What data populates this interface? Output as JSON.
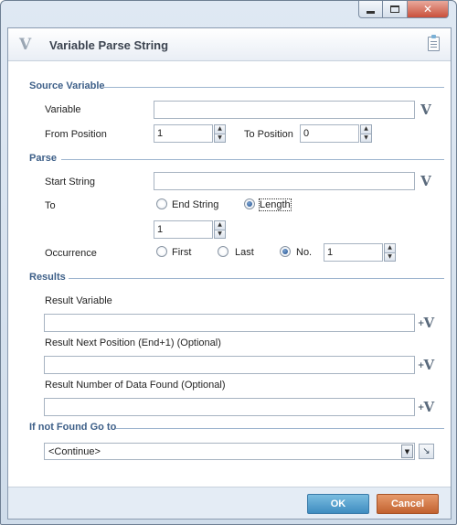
{
  "window": {
    "controls": {
      "minimize": "minimize-icon",
      "maximize": "maximize-icon",
      "close": "close-icon"
    }
  },
  "header": {
    "logo": "V",
    "title": "Variable Parse String"
  },
  "source_variable": {
    "section": "Source Variable",
    "variable_label": "Variable",
    "variable_value": "",
    "from_label": "From Position",
    "from_value": "1",
    "to_label": "To Position",
    "to_value": "0"
  },
  "parse": {
    "section": "Parse",
    "start_string_label": "Start String",
    "start_string_value": "",
    "to_label": "To",
    "end_string_label": "End String",
    "length_label": "Length",
    "length_selected": true,
    "length_value": "1",
    "occurrence_label": "Occurrence",
    "first_label": "First",
    "last_label": "Last",
    "no_label": "No.",
    "no_selected": true,
    "no_value": "1"
  },
  "results": {
    "section": "Results",
    "result_variable_label": "Result Variable",
    "result_variable_value": "",
    "next_position_label": "Result Next Position (End+1) (Optional)",
    "next_position_value": "",
    "data_found_label": "Result Number of Data Found (Optional)",
    "data_found_value": ""
  },
  "not_found": {
    "section": "If not Found Go to",
    "selected": "<Continue>"
  },
  "footer": {
    "ok_label": "OK",
    "cancel_label": "Cancel"
  },
  "icons": {
    "variable_picker": "V",
    "add_variable": "+V"
  }
}
